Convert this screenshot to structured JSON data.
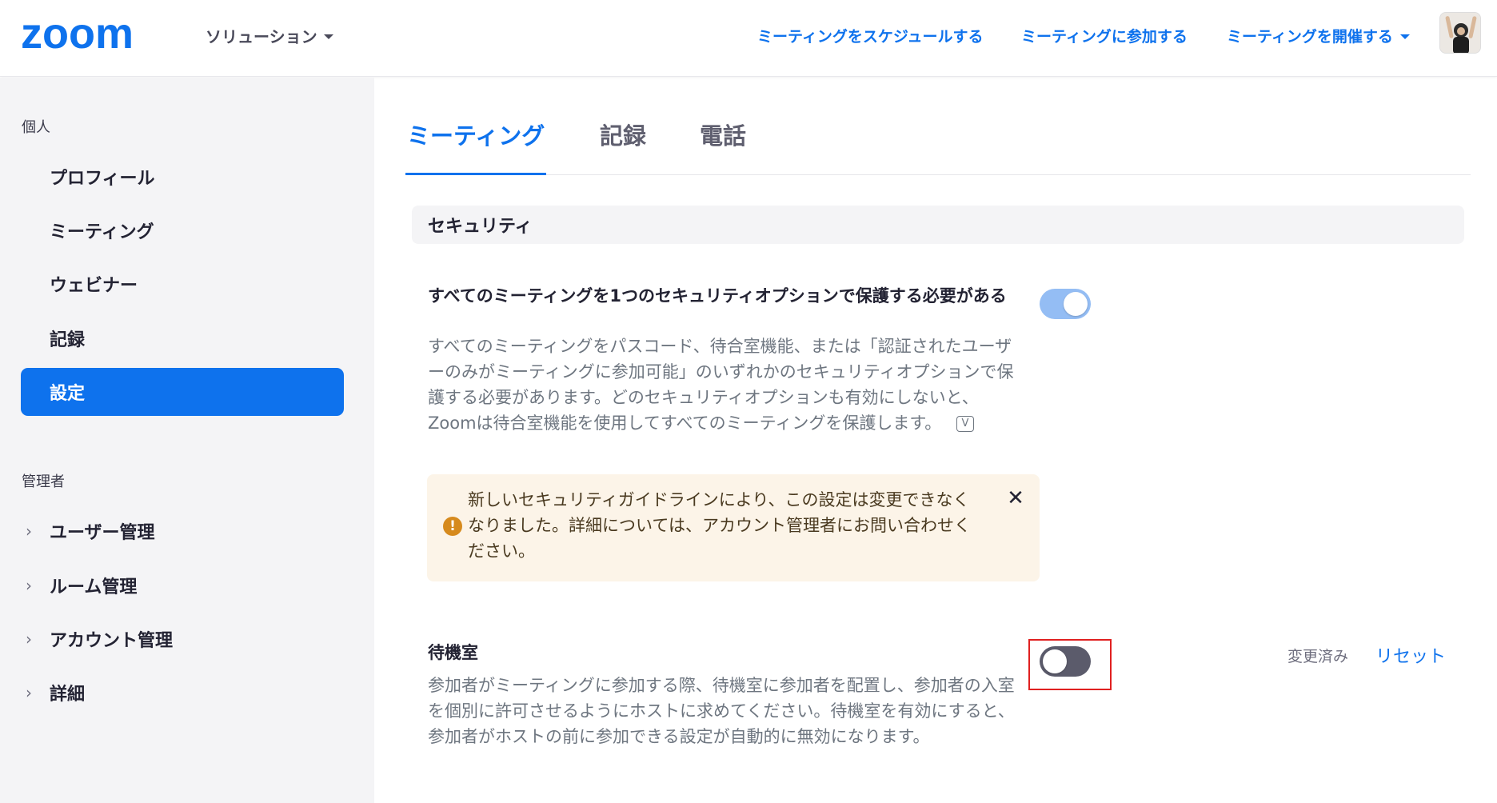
{
  "header": {
    "logo_text": "zoom",
    "solutions_label": "ソリューション",
    "nav": [
      {
        "label": "ミーティングをスケジュールする"
      },
      {
        "label": "ミーティングに参加する"
      },
      {
        "label": "ミーティングを開催する"
      }
    ]
  },
  "sidebar": {
    "personal_heading": "個人",
    "personal_items": [
      {
        "label": "プロフィール"
      },
      {
        "label": "ミーティング"
      },
      {
        "label": "ウェビナー"
      },
      {
        "label": "記録"
      },
      {
        "label": "設定",
        "active": true
      }
    ],
    "admin_heading": "管理者",
    "admin_items": [
      {
        "label": "ユーザー管理"
      },
      {
        "label": "ルーム管理"
      },
      {
        "label": "アカウント管理"
      },
      {
        "label": "詳細"
      }
    ]
  },
  "tabs": [
    {
      "label": "ミーティング",
      "active": true
    },
    {
      "label": "記録"
    },
    {
      "label": "電話"
    }
  ],
  "section": {
    "title": "セキュリティ"
  },
  "settings": {
    "require_security": {
      "title": "すべてのミーティングを1つのセキュリティオプションで保護する必要がある",
      "description": "すべてのミーティングをパスコード、待合室機能、または「認証されたユーザーのみがミーティングに参加可能」のいずれかのセキュリティオプションで保護する必要があります。どのセキュリティオプションも有効にしないと、Zoomは待合室機能を使用してすべてのミーティングを保護します。",
      "video_icon_glyph": "V",
      "enabled": true,
      "alert": "新しいセキュリティガイドラインにより、この設定は変更できなくなりました。詳細については、アカウント管理者にお問い合わせください。",
      "alert_icon_glyph": "!",
      "close_glyph": "✕"
    },
    "waiting_room": {
      "title": "待機室",
      "description": "参加者がミーティングに参加する際、待機室に参加者を配置し、参加者の入室を個別に許可させるようにホストに求めてください。待機室を有効にすると、参加者がホストの前に参加できる設定が自動的に無効になります。",
      "enabled": false,
      "changed_label": "変更済み",
      "reset_label": "リセット"
    }
  },
  "colors": {
    "brand": "#0e72ed",
    "toggle_on": "#94bdf4",
    "toggle_off": "#5b5b6b",
    "alert_bg": "#fcf4e8",
    "alert_icon": "#d68a1d",
    "highlight": "#e02020"
  }
}
